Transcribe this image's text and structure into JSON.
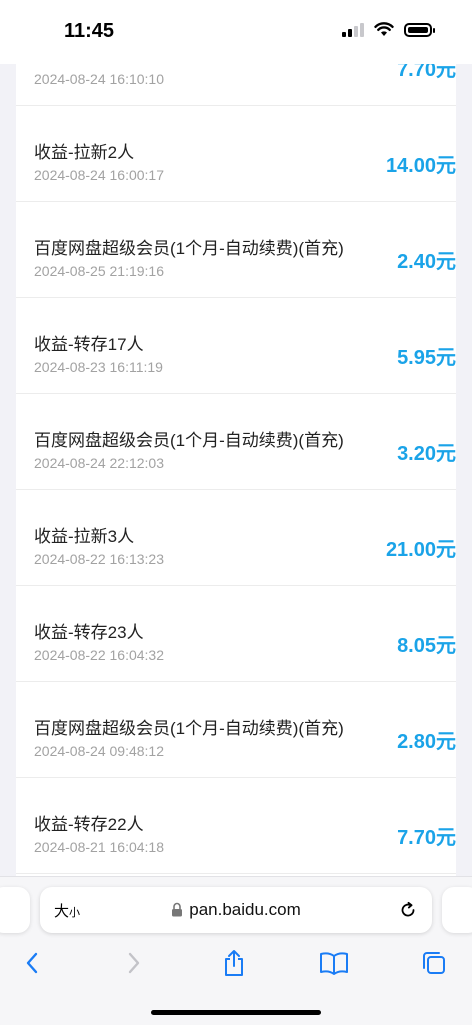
{
  "status_bar": {
    "time": "11:45"
  },
  "records": [
    {
      "title": "",
      "time": "2024-08-24 16:10:10",
      "amount": "7.70元"
    },
    {
      "title": "收益-拉新2人",
      "time": "2024-08-24 16:00:17",
      "amount": "14.00元"
    },
    {
      "title": "百度网盘超级会员(1个月-自动续费)(首充)",
      "time": "2024-08-25 21:19:16",
      "amount": "2.40元"
    },
    {
      "title": "收益-转存17人",
      "time": "2024-08-23 16:11:19",
      "amount": "5.95元"
    },
    {
      "title": "百度网盘超级会员(1个月-自动续费)(首充)",
      "time": "2024-08-24 22:12:03",
      "amount": "3.20元"
    },
    {
      "title": "收益-拉新3人",
      "time": "2024-08-22 16:13:23",
      "amount": "21.00元"
    },
    {
      "title": "收益-转存23人",
      "time": "2024-08-22 16:04:32",
      "amount": "8.05元"
    },
    {
      "title": "百度网盘超级会员(1个月-自动续费)(首充)",
      "time": "2024-08-24 09:48:12",
      "amount": "2.80元"
    },
    {
      "title": "收益-转存22人",
      "time": "2024-08-21 16:04:18",
      "amount": "7.70元"
    }
  ],
  "browser": {
    "text_size_label": "大",
    "text_size_small": "小",
    "url": "pan.baidu.com"
  },
  "colors": {
    "amount": "#1aa3e8",
    "nav_active": "#1a7cf5",
    "nav_disabled": "#c3c3c8"
  },
  "icons": [
    "lock-icon",
    "reload-icon",
    "back-icon",
    "forward-icon",
    "share-icon",
    "bookmarks-icon",
    "tabs-icon"
  ]
}
